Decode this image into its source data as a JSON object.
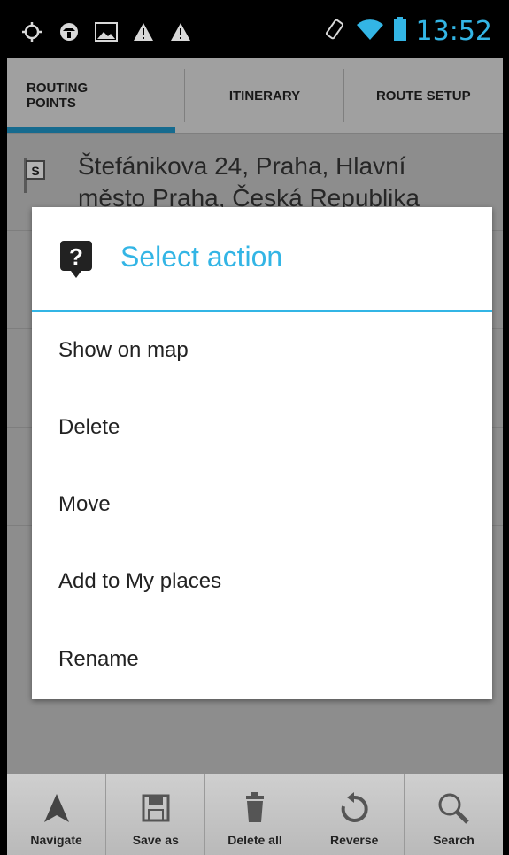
{
  "status_bar": {
    "time": "13:52",
    "left_icons": [
      "gps-icon",
      "navigation-icon",
      "image-icon",
      "warning-icon",
      "warning-icon"
    ],
    "right_icons": [
      "rotation-icon",
      "wifi-icon",
      "battery-icon"
    ]
  },
  "tabs": [
    {
      "label": "ROUTING\nPOINTS",
      "active": true
    },
    {
      "label": "ITINERARY",
      "active": false
    },
    {
      "label": "ROUTE SETUP",
      "active": false
    }
  ],
  "routing_points": [
    {
      "flag": "S",
      "address": "Štefánikova 24, Praha, Hlavní\nměsto Praha, Česká Republika"
    }
  ],
  "dialog": {
    "title": "Select action",
    "items": [
      "Show on map",
      "Delete",
      "Move",
      "Add to My places",
      "Rename"
    ]
  },
  "toolbar": [
    {
      "label": "Navigate",
      "icon": "navigate-icon"
    },
    {
      "label": "Save as",
      "icon": "save-icon"
    },
    {
      "label": "Delete all",
      "icon": "trash-icon"
    },
    {
      "label": "Reverse",
      "icon": "reverse-icon"
    },
    {
      "label": "Search",
      "icon": "search-icon"
    }
  ],
  "colors": {
    "accent": "#33b5e5",
    "tab_indicator": "#1e8fbf"
  }
}
